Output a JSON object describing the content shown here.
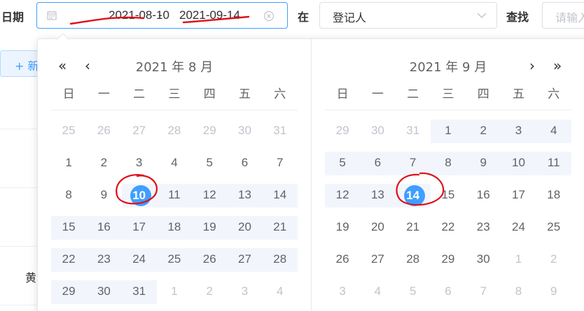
{
  "filter": {
    "date_label": "日期",
    "start_value": "2021-08-10",
    "separator": "-",
    "end_value": "2021-09-14",
    "at_label": "在",
    "field_value": "登记人",
    "search_label": "查找",
    "search_placeholder": "请输入"
  },
  "background": {
    "add_button": "+ 新",
    "cell_text": "黄"
  },
  "picker": {
    "weekdays": [
      "日",
      "一",
      "二",
      "三",
      "四",
      "五",
      "六"
    ],
    "left": {
      "title": "2021 年 8 月",
      "nav_prev_year": "«",
      "nav_prev_month": "‹",
      "days": [
        [
          "25",
          "26",
          "27",
          "28",
          "29",
          "30",
          "31"
        ],
        [
          "1",
          "2",
          "3",
          "4",
          "5",
          "6",
          "7"
        ],
        [
          "8",
          "9",
          "10",
          "11",
          "12",
          "13",
          "14"
        ],
        [
          "15",
          "16",
          "17",
          "18",
          "19",
          "20",
          "21"
        ],
        [
          "22",
          "23",
          "24",
          "25",
          "26",
          "27",
          "28"
        ],
        [
          "29",
          "30",
          "31",
          "1",
          "2",
          "3",
          "4"
        ]
      ]
    },
    "right": {
      "title": "2021 年 9 月",
      "nav_next_month": "›",
      "nav_next_year": "»",
      "days": [
        [
          "29",
          "30",
          "31",
          "1",
          "2",
          "3",
          "4"
        ],
        [
          "5",
          "6",
          "7",
          "8",
          "9",
          "10",
          "11"
        ],
        [
          "12",
          "13",
          "14",
          "15",
          "16",
          "17",
          "18"
        ],
        [
          "19",
          "20",
          "21",
          "22",
          "23",
          "24",
          "25"
        ],
        [
          "26",
          "27",
          "28",
          "29",
          "30",
          "1",
          "2"
        ],
        [
          "3",
          "4",
          "5",
          "6",
          "7",
          "8",
          "9"
        ]
      ]
    },
    "selected_start": "2021-08-10",
    "selected_end": "2021-09-14"
  },
  "colors": {
    "accent": "#409eff",
    "range_band": "#f2f6fc",
    "annotation_red": "#e0101a"
  }
}
